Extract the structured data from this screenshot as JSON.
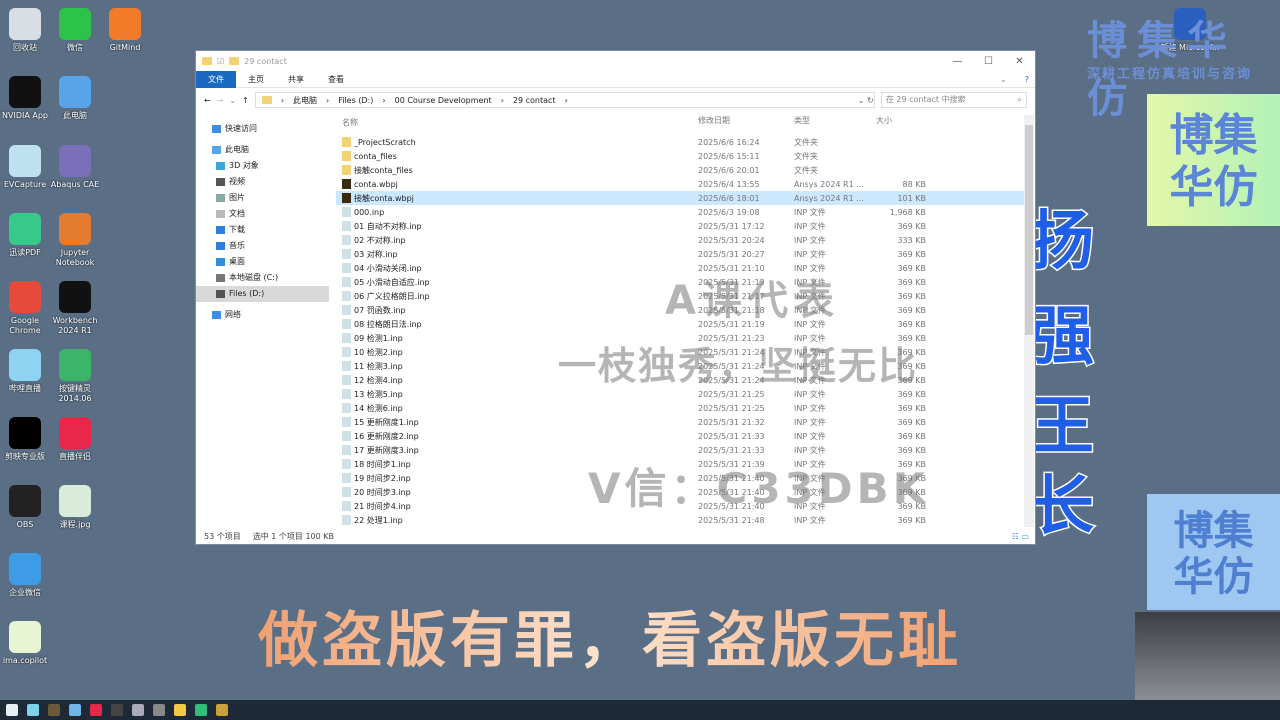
{
  "desktop": {
    "icons": [
      {
        "label": "回收站",
        "color": "#d8dde4"
      },
      {
        "label": "微信",
        "color": "#2dc24a"
      },
      {
        "label": "GitMind",
        "color": "#f27b2a"
      },
      {
        "label": "NVIDIA App",
        "color": "#111"
      },
      {
        "label": "此电脑",
        "color": "#59a4e8"
      },
      {
        "label": "EVCapture",
        "color": "#bfe0ee"
      },
      {
        "label": "Abaqus CAE",
        "color": "#7a6fb8"
      },
      {
        "label": "迅读PDF",
        "color": "#38c88a"
      },
      {
        "label": "Jupyter Notebook",
        "color": "#e57b2e"
      },
      {
        "label": "Google Chrome",
        "color": "#e64a3b"
      },
      {
        "label": "Workbench 2024 R1",
        "color": "#111"
      },
      {
        "label": "哔哩直播",
        "color": "#8fd3f2"
      },
      {
        "label": "按键精灵 2014.06",
        "color": "#3bb56a"
      },
      {
        "label": "剪映专业版",
        "color": "#000"
      },
      {
        "label": "直播伴侣",
        "color": "#e8284a"
      },
      {
        "label": "OBS",
        "color": "#222"
      },
      {
        "label": "课程.jpg",
        "color": "#d8ecd9"
      },
      {
        "label": "企业微信",
        "color": "#3d9be8"
      },
      {
        "label": "ima.copilot",
        "color": "#e8f5d2"
      },
      {
        "label": "新建 Microsof...",
        "color": "#2b5fbd"
      }
    ]
  },
  "brand": {
    "title": "博集华仿",
    "subtitle": "深耕工程仿真培训与咨询",
    "box1": "博集华仿",
    "box2": "博集华仿",
    "vertical": [
      "扬",
      "强",
      "王",
      "长"
    ]
  },
  "slogan": "做盗版有罪，看盗版无耻",
  "watermarks": [
    "A课代表",
    "一枝独秀，坚挺无比",
    "V信：C33DBK"
  ],
  "explorer": {
    "title": "29 contact",
    "ribbon": [
      "文件",
      "主页",
      "共享",
      "查看"
    ],
    "path": [
      "此电脑",
      "Files (D:)",
      "00 Course Development",
      "29 contact"
    ],
    "search_placeholder": "在 29 contact 中搜索",
    "sidebar": [
      {
        "label": "快速访问",
        "icon": "star-icon",
        "color": "#3a8ee6",
        "indent": 0
      },
      {
        "label": "此电脑",
        "icon": "computer-icon",
        "color": "#59a4e8",
        "indent": 0
      },
      {
        "label": "3D 对象",
        "icon": "cube-icon",
        "color": "#39a7d8",
        "indent": 1
      },
      {
        "label": "视频",
        "icon": "video-icon",
        "color": "#555",
        "indent": 1
      },
      {
        "label": "图片",
        "icon": "picture-icon",
        "color": "#8aa",
        "indent": 1
      },
      {
        "label": "文档",
        "icon": "document-icon",
        "color": "#bbb",
        "indent": 1
      },
      {
        "label": "下载",
        "icon": "download-icon",
        "color": "#2d7fe0",
        "indent": 1
      },
      {
        "label": "音乐",
        "icon": "music-icon",
        "color": "#2d7fe0",
        "indent": 1
      },
      {
        "label": "桌面",
        "icon": "desktop-icon",
        "color": "#2d8ee0",
        "indent": 1
      },
      {
        "label": "本地磁盘 (C:)",
        "icon": "drive-icon",
        "color": "#777",
        "indent": 1
      },
      {
        "label": "Files (D:)",
        "icon": "drive-icon",
        "color": "#555",
        "indent": 1,
        "selected": true
      },
      {
        "label": "网络",
        "icon": "network-icon",
        "color": "#3a8ee6",
        "indent": 0
      }
    ],
    "columns": [
      "名称",
      "修改日期",
      "类型",
      "大小"
    ],
    "files": [
      [
        "_ProjectScratch",
        "2025/6/6 16:24",
        "文件夹",
        "",
        "folder"
      ],
      [
        "conta_files",
        "2025/6/6 15:11",
        "文件夹",
        "",
        "folder"
      ],
      [
        "接触conta_files",
        "2025/6/6 20:01",
        "文件夹",
        "",
        "folder"
      ],
      [
        "conta.wbpj",
        "2025/6/4 13:55",
        "Ansys 2024 R1 ...",
        "88 KB",
        "wbpj"
      ],
      [
        "接触conta.wbpj",
        "2025/6/6 18:01",
        "Ansys 2024 R1 ...",
        "101 KB",
        "wbpj"
      ],
      [
        "000.inp",
        "2025/6/3 19:08",
        "INP 文件",
        "1,968 KB",
        "inp"
      ],
      [
        "01 自动不对称.inp",
        "2025/5/31 17:12",
        "INP 文件",
        "369 KB",
        "inp"
      ],
      [
        "02 不对称.inp",
        "2025/5/31 20:24",
        "INP 文件",
        "333 KB",
        "inp"
      ],
      [
        "03 对称.inp",
        "2025/5/31 20:27",
        "INP 文件",
        "369 KB",
        "inp"
      ],
      [
        "04 小滑动关闭.inp",
        "2025/5/31 21:10",
        "INP 文件",
        "369 KB",
        "inp"
      ],
      [
        "05 小滑动自适应.inp",
        "2025/5/31 21:13",
        "INP 文件",
        "369 KB",
        "inp"
      ],
      [
        "06 广义拉格朗日.inp",
        "2025/5/31 21:17",
        "INP 文件",
        "369 KB",
        "inp"
      ],
      [
        "07 罚函数.inp",
        "2025/5/31 21:18",
        "INP 文件",
        "369 KB",
        "inp"
      ],
      [
        "08 拉格朗日法.inp",
        "2025/5/31 21:19",
        "INP 文件",
        "369 KB",
        "inp"
      ],
      [
        "09 检测1.inp",
        "2025/5/31 21:23",
        "INP 文件",
        "369 KB",
        "inp"
      ],
      [
        "10 检测2.inp",
        "2025/5/31 21:24",
        "INP 文件",
        "369 KB",
        "inp"
      ],
      [
        "11 检测3.inp",
        "2025/5/31 21:24",
        "INP 文件",
        "369 KB",
        "inp"
      ],
      [
        "12 检测4.inp",
        "2025/5/31 21:24",
        "INP 文件",
        "369 KB",
        "inp"
      ],
      [
        "13 检测5.inp",
        "2025/5/31 21:25",
        "INP 文件",
        "369 KB",
        "inp"
      ],
      [
        "14 检测6.inp",
        "2025/5/31 21:25",
        "INP 文件",
        "369 KB",
        "inp"
      ],
      [
        "15 更新刚度1.inp",
        "2025/5/31 21:32",
        "INP 文件",
        "369 KB",
        "inp"
      ],
      [
        "16 更新刚度2.inp",
        "2025/5/31 21:33",
        "INP 文件",
        "369 KB",
        "inp"
      ],
      [
        "17 更新刚度3.inp",
        "2025/5/31 21:33",
        "INP 文件",
        "369 KB",
        "inp"
      ],
      [
        "18 时间步1.inp",
        "2025/5/31 21:39",
        "INP 文件",
        "369 KB",
        "inp"
      ],
      [
        "19 时间步2.inp",
        "2025/5/31 21:40",
        "INP 文件",
        "369 KB",
        "inp"
      ],
      [
        "20 时间步3.inp",
        "2025/5/31 21:40",
        "INP 文件",
        "369 KB",
        "inp"
      ],
      [
        "21 时间步4.inp",
        "2025/5/31 21:40",
        "INP 文件",
        "369 KB",
        "inp"
      ],
      [
        "22 处理1.inp",
        "2025/5/31 21:48",
        "INP 文件",
        "369 KB",
        "inp"
      ]
    ],
    "selected_index": 4,
    "status": {
      "count": "53 个项目",
      "selection": "选中 1 个项目  100 KB"
    }
  },
  "taskbar": {
    "apps": [
      {
        "name": "start",
        "color": "#e8eef5"
      },
      {
        "name": "bilibili",
        "color": "#7cd4e8"
      },
      {
        "name": "word",
        "color": "#6b5a3a"
      },
      {
        "name": "control-panel",
        "color": "#6fb5e8"
      },
      {
        "name": "live",
        "color": "#e8284a"
      },
      {
        "name": "obs",
        "color": "#444"
      },
      {
        "name": "paint",
        "color": "#aab"
      },
      {
        "name": "notepad",
        "color": "#888"
      },
      {
        "name": "explorer",
        "color": "#f3c843"
      },
      {
        "name": "app-green",
        "color": "#2fbf7a"
      },
      {
        "name": "workbench",
        "color": "#c9a23a"
      }
    ]
  }
}
